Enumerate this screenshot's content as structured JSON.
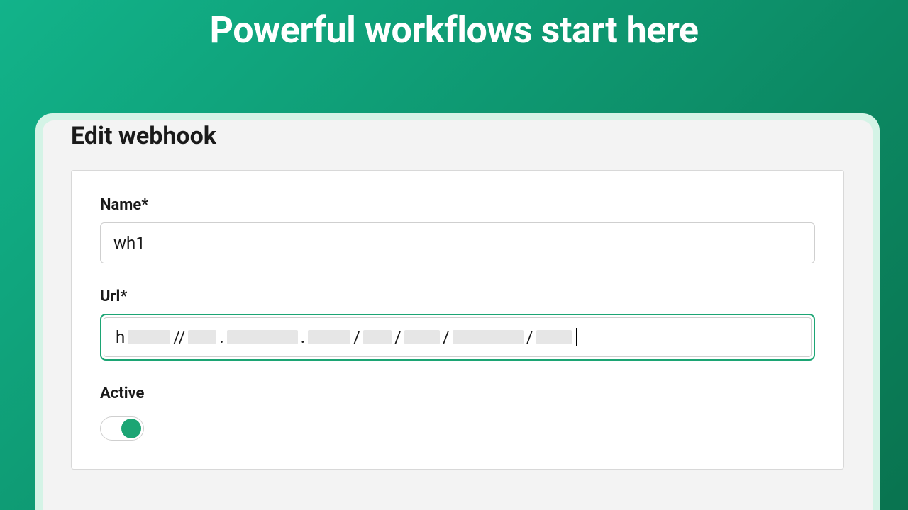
{
  "hero": {
    "title": "Powerful workflows start here"
  },
  "form": {
    "heading": "Edit webhook",
    "fields": {
      "name": {
        "label": "Name*",
        "value": "wh1"
      },
      "url": {
        "label": "Url*",
        "value": ""
      },
      "active": {
        "label": "Active",
        "checked": true
      }
    }
  }
}
